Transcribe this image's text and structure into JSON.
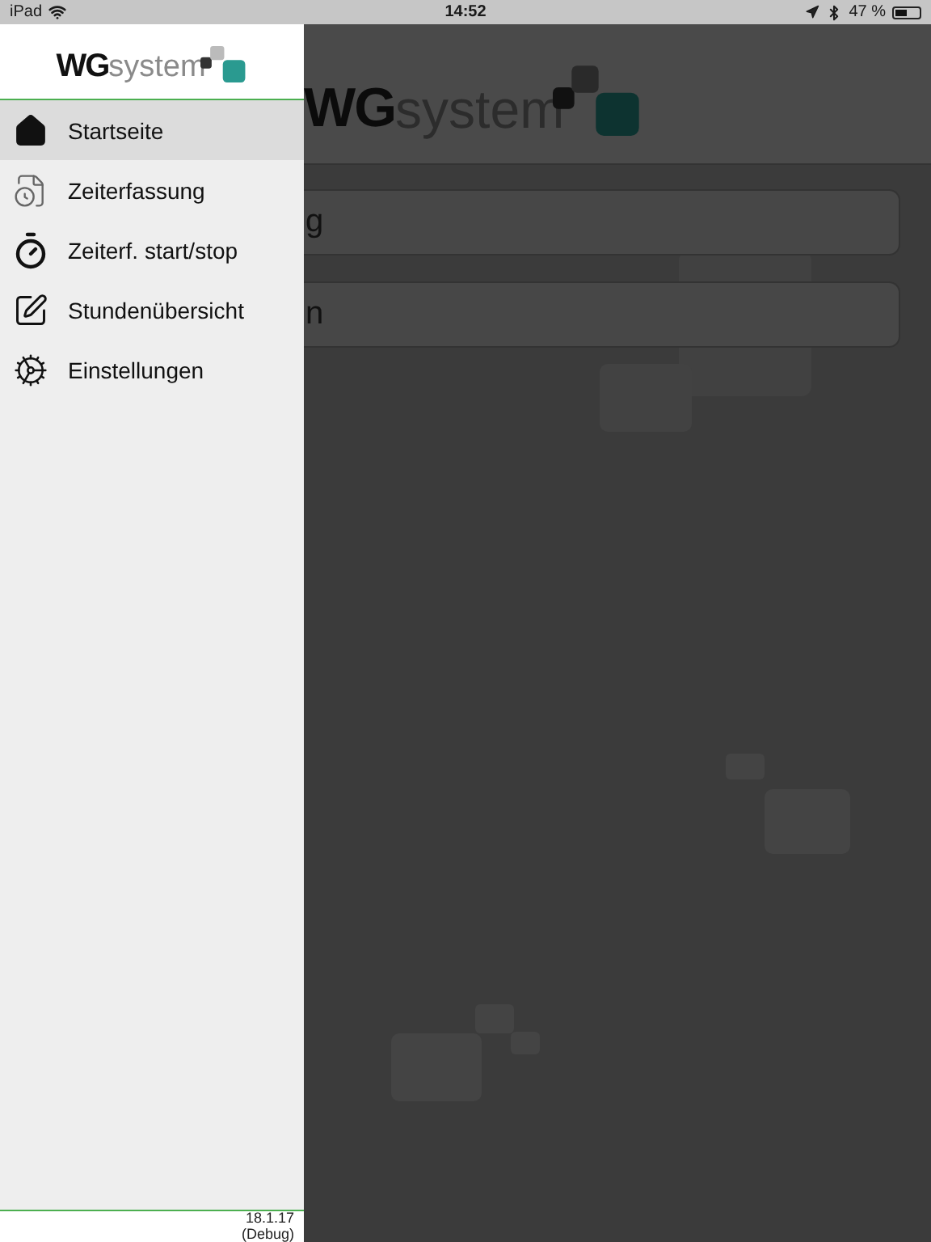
{
  "status_bar": {
    "device": "iPad",
    "time": "14:52",
    "battery": "47 %"
  },
  "drawer": {
    "logo": {
      "bold": "WG",
      "light": "system"
    },
    "items": [
      {
        "label": "Startseite",
        "selected": true
      },
      {
        "label": "Zeiterfassung",
        "selected": false
      },
      {
        "label": "Zeiterf. start/stop",
        "selected": false
      },
      {
        "label": "Stundenübersicht",
        "selected": false
      },
      {
        "label": "Einstellungen",
        "selected": false
      }
    ],
    "version": [
      "18.1.17",
      "(Debug)"
    ]
  },
  "main": {
    "logo": {
      "bold": "WG",
      "light": "system"
    },
    "buttons": [
      "g",
      "n"
    ]
  }
}
